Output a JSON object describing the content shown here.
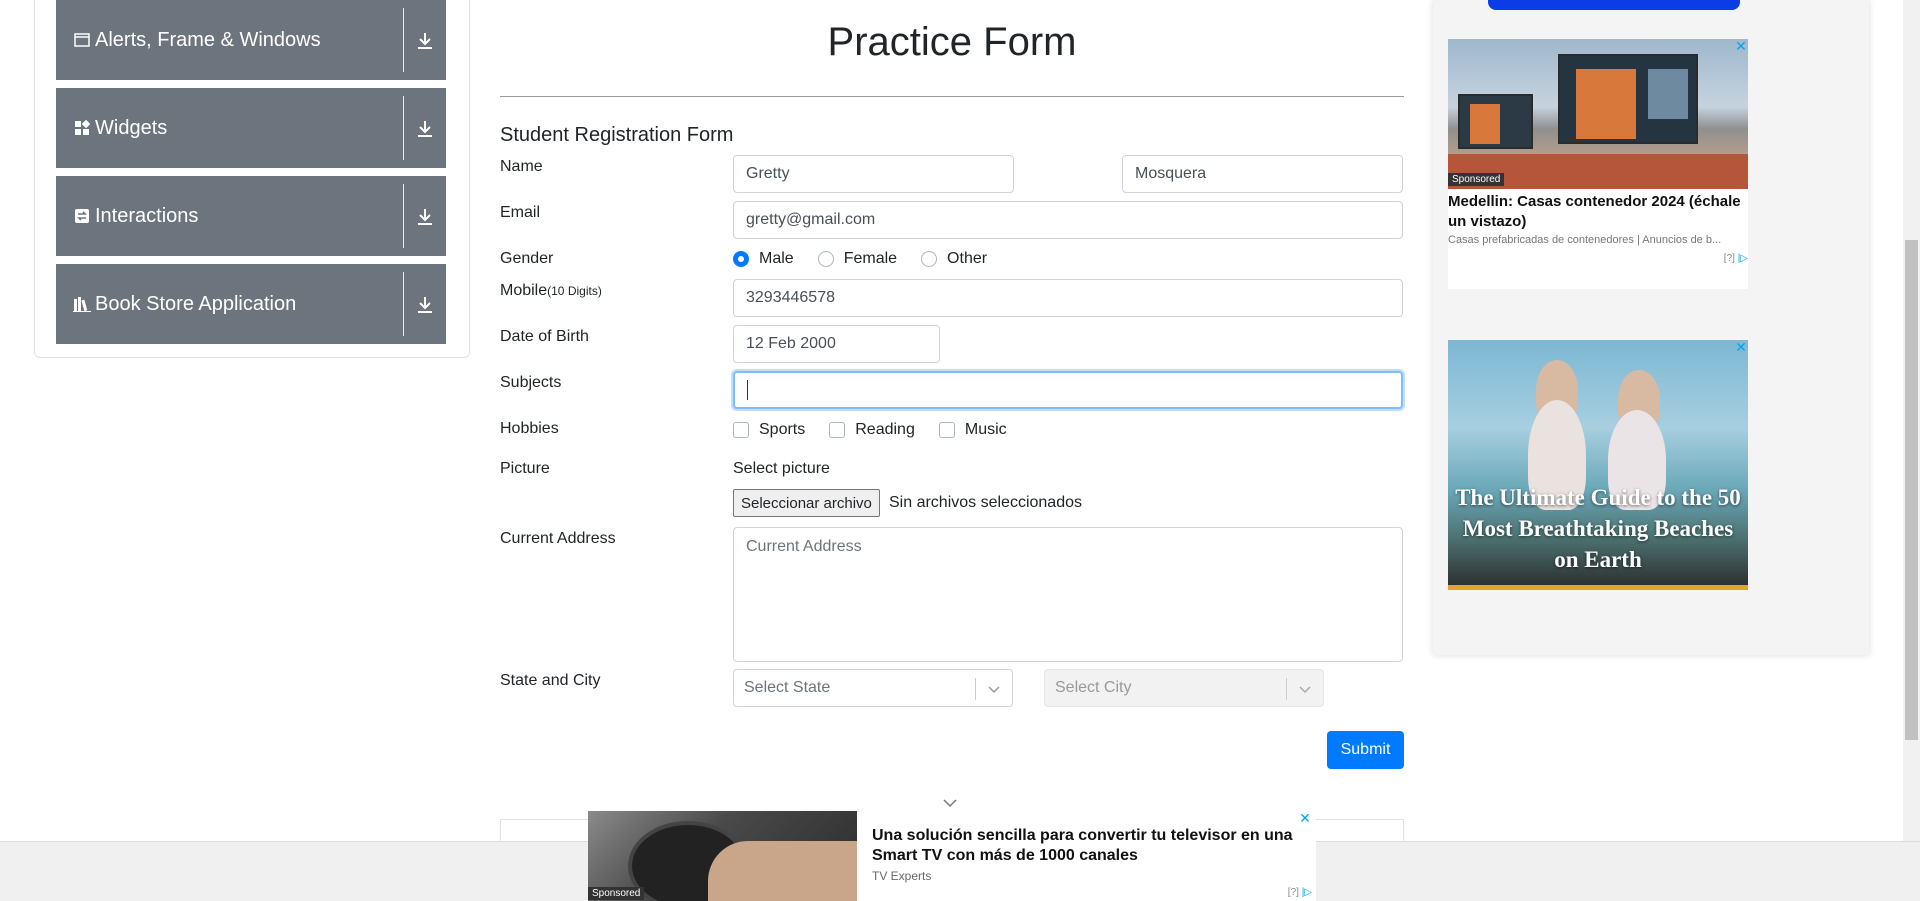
{
  "sidebar": {
    "groups": [
      {
        "label": "Alerts, Frame & Windows",
        "icon": "window-icon"
      },
      {
        "label": "Widgets",
        "icon": "widgets-icon"
      },
      {
        "label": "Interactions",
        "icon": "interactions-icon"
      },
      {
        "label": "Book Store Application",
        "icon": "books-icon"
      }
    ]
  },
  "form": {
    "title": "Practice Form",
    "subtitle": "Student Registration Form",
    "labels": {
      "name": "Name",
      "email": "Email",
      "gender": "Gender",
      "mobile": "Mobile",
      "mobile_hint": "(10 Digits)",
      "dob": "Date of Birth",
      "subjects": "Subjects",
      "hobbies": "Hobbies",
      "picture": "Picture",
      "address": "Current Address",
      "state_city": "State and City"
    },
    "first_name": "Gretty",
    "last_name": "Mosquera",
    "email": "gretty@gmail.com",
    "gender_options": [
      "Male",
      "Female",
      "Other"
    ],
    "gender_selected": "Male",
    "mobile": "3293446578",
    "dob": "12 Feb 2000",
    "subjects": "",
    "hobbies": [
      "Sports",
      "Reading",
      "Music"
    ],
    "picture_label": "Select picture",
    "file_button": "Seleccionar archivo",
    "file_status": "Sin archivos seleccionados",
    "address_placeholder": "Current Address",
    "state_placeholder": "Select State",
    "city_placeholder": "Select City",
    "submit": "Submit"
  },
  "ads": {
    "ad1": {
      "tag": "Sponsored",
      "headline": "Medellin: Casas contenedor 2024 (échale un vistazo)",
      "description": "Casas prefabricadas de contenedores | Anuncios de b...",
      "choice": "[?]"
    },
    "ad2": {
      "caption": "The Ultimate Guide to the 50 Most Breathtaking Beaches on Earth"
    },
    "bottom": {
      "tag": "Sponsored",
      "headline": "Una solución sencilla para convertir tu televisor en una Smart TV con más de 1000 canales",
      "source": "TV Experts",
      "choice": "[?]"
    }
  },
  "colors": {
    "sidebar_group_bg": "#6c757d",
    "primary": "#007bff",
    "focus_border": "#80bdff"
  }
}
